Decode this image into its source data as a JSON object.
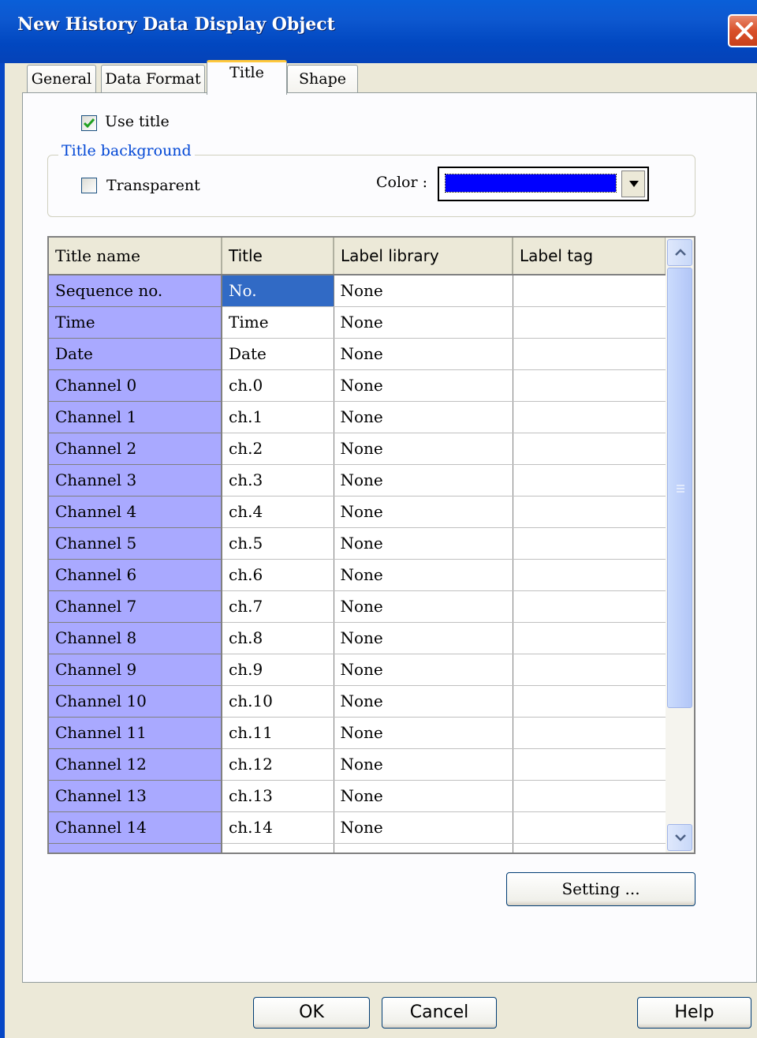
{
  "window": {
    "title": "New  History Data Display Object"
  },
  "tabs": [
    {
      "label": "General",
      "active": false
    },
    {
      "label": "Data Format",
      "active": false
    },
    {
      "label": "Title",
      "active": true
    },
    {
      "label": "Shape",
      "active": false
    }
  ],
  "use_title": {
    "label": "Use title",
    "checked": true
  },
  "title_background": {
    "legend": "Title background",
    "transparent": {
      "label": "Transparent",
      "checked": false
    },
    "color_label": "Color :",
    "color_value": "#0000FF"
  },
  "grid": {
    "headers": [
      "Title name",
      "Title",
      "Label library",
      "Label tag"
    ],
    "rows": [
      {
        "name": "Sequence no.",
        "title": "No.",
        "library": "None",
        "tag": ""
      },
      {
        "name": "Time",
        "title": "Time",
        "library": "None",
        "tag": ""
      },
      {
        "name": "Date",
        "title": "Date",
        "library": "None",
        "tag": ""
      },
      {
        "name": "Channel 0",
        "title": "ch.0",
        "library": "None",
        "tag": ""
      },
      {
        "name": "Channel 1",
        "title": "ch.1",
        "library": "None",
        "tag": ""
      },
      {
        "name": "Channel 2",
        "title": "ch.2",
        "library": "None",
        "tag": ""
      },
      {
        "name": "Channel 3",
        "title": "ch.3",
        "library": "None",
        "tag": ""
      },
      {
        "name": "Channel 4",
        "title": "ch.4",
        "library": "None",
        "tag": ""
      },
      {
        "name": "Channel 5",
        "title": "ch.5",
        "library": "None",
        "tag": ""
      },
      {
        "name": "Channel 6",
        "title": "ch.6",
        "library": "None",
        "tag": ""
      },
      {
        "name": "Channel 7",
        "title": "ch.7",
        "library": "None",
        "tag": ""
      },
      {
        "name": "Channel 8",
        "title": "ch.8",
        "library": "None",
        "tag": ""
      },
      {
        "name": "Channel 9",
        "title": "ch.9",
        "library": "None",
        "tag": ""
      },
      {
        "name": "Channel 10",
        "title": "ch.10",
        "library": "None",
        "tag": ""
      },
      {
        "name": "Channel 11",
        "title": "ch.11",
        "library": "None",
        "tag": ""
      },
      {
        "name": "Channel 12",
        "title": "ch.12",
        "library": "None",
        "tag": ""
      },
      {
        "name": "Channel 13",
        "title": "ch.13",
        "library": "None",
        "tag": ""
      },
      {
        "name": "Channel 14",
        "title": "ch.14",
        "library": "None",
        "tag": ""
      },
      {
        "name": "",
        "title": "",
        "library": "",
        "tag": ""
      }
    ]
  },
  "buttons": {
    "setting": "Setting ...",
    "ok": "OK",
    "cancel": "Cancel",
    "help": "Help"
  },
  "colors": {
    "titlebar": "#0147C0",
    "row_header_bg": "#A9A9FF",
    "selected_cell": "#316AC5",
    "group_legend": "#0046D5",
    "swatch": "#0000FF"
  }
}
